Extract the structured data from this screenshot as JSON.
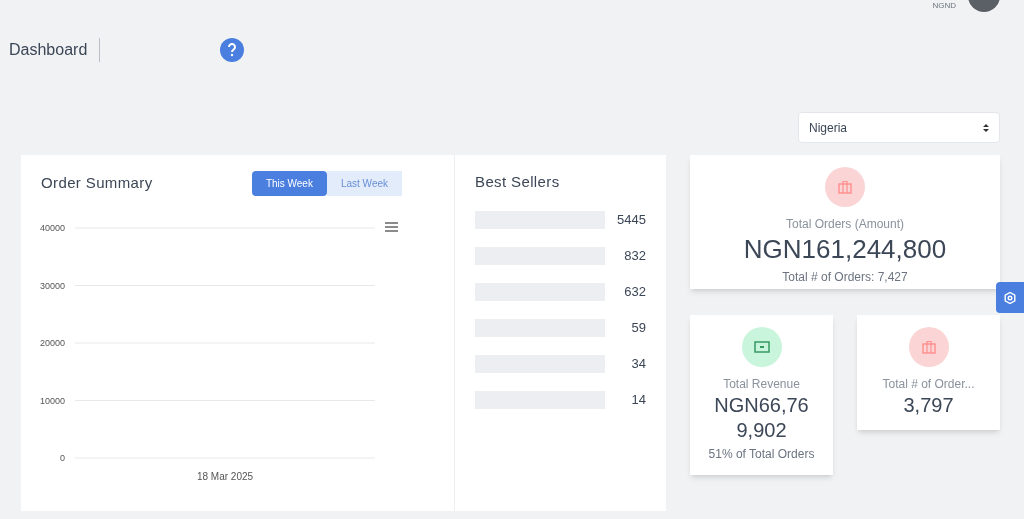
{
  "header": {
    "user_label": "NGND"
  },
  "page": {
    "title": "Dashboard"
  },
  "country_select": {
    "value": "Nigeria"
  },
  "order_summary": {
    "title": "Order Summary",
    "tabs": [
      {
        "label": "This Week",
        "selected": true
      },
      {
        "label": "Last Week",
        "selected": false
      }
    ],
    "chart_data": {
      "type": "line",
      "categories": [
        "18 Mar 2025"
      ],
      "ylim": [
        0,
        40000
      ],
      "grid": true,
      "yticks": [
        0,
        10000,
        20000,
        30000,
        40000
      ]
    }
  },
  "best_sellers": {
    "title": "Best Sellers",
    "items": [
      {
        "count": "5445"
      },
      {
        "count": "832"
      },
      {
        "count": "632"
      },
      {
        "count": "59"
      },
      {
        "count": "34"
      },
      {
        "count": "14"
      }
    ]
  },
  "stats": [
    {
      "kind": "wide",
      "color": "#fbd5d5",
      "label": "Total Orders (Amount)",
      "value": "NGN161,244,800",
      "note": "Total # of Orders: 7,427"
    },
    {
      "kind": "small",
      "color": "#c8f5dc",
      "label": "Total Revenue",
      "value": "NGN66,76 9,902",
      "note": "51% of Total Orders"
    },
    {
      "kind": "small",
      "color": "#fbd5d5",
      "label": "Total # of Order...",
      "value": "3,797"
    }
  ]
}
